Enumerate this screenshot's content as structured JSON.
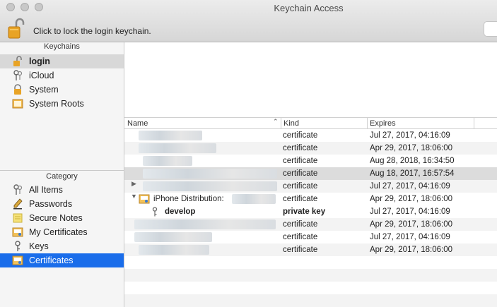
{
  "window": {
    "title": "Keychain Access"
  },
  "toolbar": {
    "lock_text": "Click to lock the login keychain."
  },
  "sidebar": {
    "keychains_header": "Keychains",
    "keychains": [
      {
        "label": "login",
        "icon": "open-lock-icon"
      },
      {
        "label": "iCloud",
        "icon": "key-ring-icon"
      },
      {
        "label": "System",
        "icon": "lock-icon"
      },
      {
        "label": "System Roots",
        "icon": "folder-cert-icon"
      }
    ],
    "category_header": "Category",
    "categories": [
      {
        "label": "All Items",
        "icon": "key-ring-icon"
      },
      {
        "label": "Passwords",
        "icon": "pen-icon"
      },
      {
        "label": "Secure Notes",
        "icon": "note-icon"
      },
      {
        "label": "My Certificates",
        "icon": "certificate-icon"
      },
      {
        "label": "Keys",
        "icon": "key-icon"
      },
      {
        "label": "Certificates",
        "icon": "certificate-icon"
      }
    ]
  },
  "table": {
    "columns": {
      "name": "Name",
      "kind": "Kind",
      "expires": "Expires"
    },
    "rows": [
      {
        "name": "",
        "kind": "certificate",
        "expires": "Jul 27, 2017, 04:16:09"
      },
      {
        "name": "",
        "kind": "certificate",
        "expires": "Apr 29, 2017, 18:06:00"
      },
      {
        "name": "",
        "kind": "certificate",
        "expires": "Aug 28, 2018, 16:34:50"
      },
      {
        "name": "",
        "kind": "certificate",
        "expires": "Aug 18, 2017, 16:57:54"
      },
      {
        "name": "",
        "kind": "certificate",
        "expires": "Jul 27, 2017, 04:16:09"
      },
      {
        "name": "iPhone Distribution:",
        "kind": "certificate",
        "expires": "Apr 29, 2017, 18:06:00"
      },
      {
        "name": "develop",
        "kind": "private key",
        "expires": "Jul 27, 2017, 04:16:09"
      },
      {
        "name": "",
        "kind": "certificate",
        "expires": "Apr 29, 2017, 18:06:00"
      },
      {
        "name": "",
        "kind": "certificate",
        "expires": "Jul 27, 2017, 04:16:09"
      },
      {
        "name": "",
        "kind": "certificate",
        "expires": "Apr 29, 2017, 18:06:00"
      }
    ]
  },
  "colors": {
    "selection_blue": "#1a6dea",
    "selection_gray": "#d8d8d8"
  }
}
